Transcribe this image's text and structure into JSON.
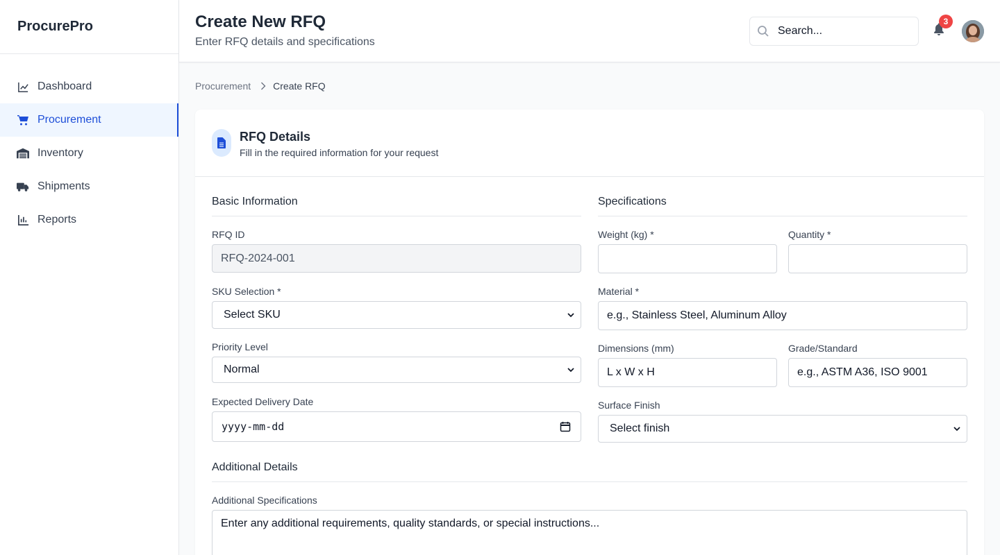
{
  "brand": "ProcurePro",
  "sidebar": {
    "items": [
      {
        "label": "Dashboard",
        "icon": "chart-line-icon",
        "active": false
      },
      {
        "label": "Procurement",
        "icon": "shopping-cart-icon",
        "active": true
      },
      {
        "label": "Inventory",
        "icon": "warehouse-icon",
        "active": false
      },
      {
        "label": "Shipments",
        "icon": "truck-icon",
        "active": false
      },
      {
        "label": "Reports",
        "icon": "bar-chart-icon",
        "active": false
      }
    ]
  },
  "header": {
    "title": "Create New RFQ",
    "subtitle": "Enter RFQ details and specifications",
    "search_placeholder": "Search...",
    "notification_count": "3"
  },
  "breadcrumb": {
    "parent": "Procurement",
    "current": "Create RFQ"
  },
  "card": {
    "title": "RFQ Details",
    "subtitle": "Fill in the required information for your request"
  },
  "basic": {
    "section_title": "Basic Information",
    "rfq_id_label": "RFQ ID",
    "rfq_id_value": "RFQ-2024-001",
    "sku_label": "SKU Selection *",
    "sku_value": "Select SKU",
    "priority_label": "Priority Level",
    "priority_value": "Normal",
    "delivery_label": "Expected Delivery Date",
    "delivery_placeholder": "yyyy-mm-dd"
  },
  "specs": {
    "section_title": "Specifications",
    "weight_label": "Weight (kg) *",
    "weight_value": "",
    "quantity_label": "Quantity *",
    "quantity_value": "",
    "material_label": "Material *",
    "material_placeholder": "e.g., Stainless Steel, Aluminum Alloy",
    "dimensions_label": "Dimensions (mm)",
    "dimensions_placeholder": "L x W x H",
    "grade_label": "Grade/Standard",
    "grade_placeholder": "e.g., ASTM A36, ISO 9001",
    "finish_label": "Surface Finish",
    "finish_value": "Select finish"
  },
  "additional": {
    "section_title": "Additional Details",
    "spec_label": "Additional Specifications",
    "spec_placeholder": "Enter any additional requirements, quality standards, or special instructions..."
  },
  "colors": {
    "accent": "#1d4ed8",
    "accent_bg": "#eff6ff",
    "badge": "#ef4444"
  }
}
